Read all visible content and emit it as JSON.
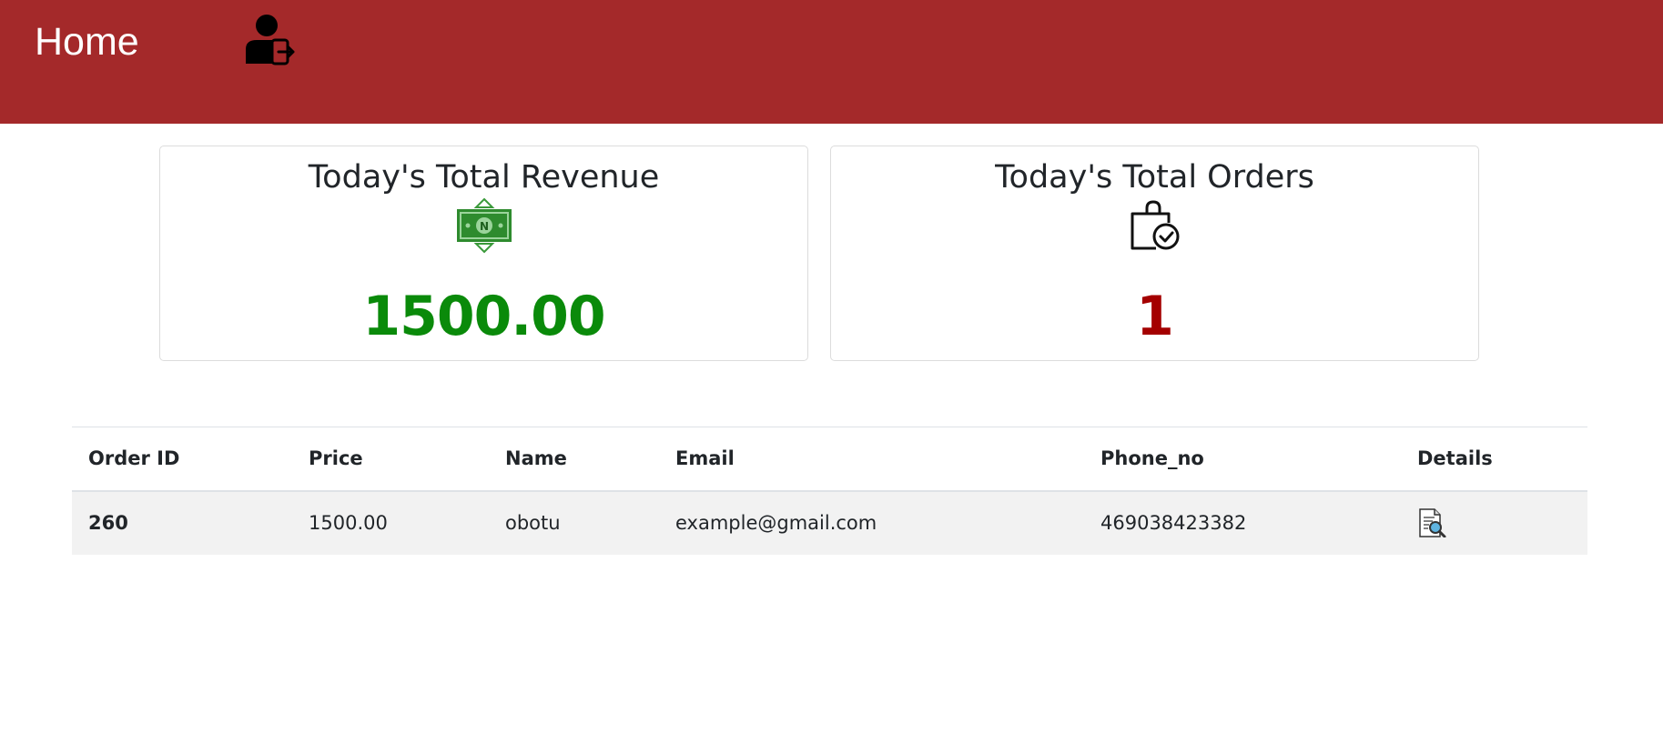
{
  "header": {
    "title": "Home",
    "background": "#a4292a",
    "logout_icon": "user-logout-icon"
  },
  "cards": {
    "revenue": {
      "title": "Today's Total Revenue",
      "icon": "naira-banknote-icon",
      "value": "1500.00",
      "color": "#0a8a0a"
    },
    "orders": {
      "title": "Today's Total Orders",
      "icon": "shopping-bag-check-icon",
      "value": "1",
      "color": "#a40000"
    }
  },
  "table": {
    "columns": [
      "Order ID",
      "Price",
      "Name",
      "Email",
      "Phone_no",
      "Details"
    ],
    "rows": [
      {
        "order_id": "260",
        "price": "1500.00",
        "name": "obotu",
        "email": "example@gmail.com",
        "phone_no": "469038423382",
        "details_icon": "document-search-icon"
      }
    ]
  }
}
